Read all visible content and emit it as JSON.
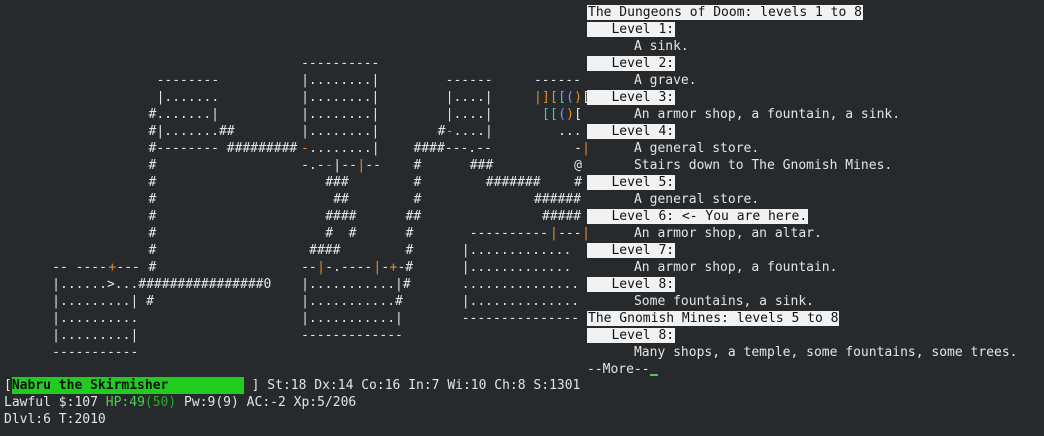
{
  "overview": {
    "lines": [
      {
        "text": "The Dungeons of Doom: levels 1 to 8",
        "kind": "header"
      },
      {
        "text": "   Level 1:",
        "kind": "level"
      },
      {
        "text": "      A sink.",
        "kind": "detail"
      },
      {
        "text": "   Level 2:",
        "kind": "level"
      },
      {
        "text": "      A grave.",
        "kind": "detail"
      },
      {
        "text": "   Level 3:",
        "kind": "level"
      },
      {
        "text": "      An armor shop, a fountain, a sink.",
        "kind": "detail"
      },
      {
        "text": "   Level 4:",
        "kind": "level"
      },
      {
        "text": "      A general store.",
        "kind": "detail"
      },
      {
        "text": "      Stairs down to The Gnomish Mines.",
        "kind": "detail"
      },
      {
        "text": "   Level 5:",
        "kind": "level"
      },
      {
        "text": "      A general store.",
        "kind": "detail"
      },
      {
        "text": "   Level 6: <- You are here.",
        "kind": "level"
      },
      {
        "text": "      An armor shop, an altar.",
        "kind": "detail"
      },
      {
        "text": "   Level 7:",
        "kind": "level"
      },
      {
        "text": "      An armor shop, a fountain.",
        "kind": "detail"
      },
      {
        "text": "   Level 8:",
        "kind": "level"
      },
      {
        "text": "      Some fountains, a sink.",
        "kind": "detail"
      },
      {
        "text": "The Gnomish Mines: levels 5 to 8",
        "kind": "header"
      },
      {
        "text": "   Level 8:",
        "kind": "level"
      },
      {
        "text": "      Many shops, a temple, some fountains, some trees.",
        "kind": "detail"
      }
    ],
    "more_prompt": "--More--"
  },
  "status": {
    "name": "Nabru the Skirmisher",
    "attributes": "] St:18 Dx:14 Co:16 In:7 Wi:10 Ch:8 S:1301",
    "alignment": "Lawful",
    "gold": "$:107",
    "hp_label": "HP:49",
    "hp_max": "(50)",
    "power": "Pw:9(9)",
    "ac": "AC:-2",
    "xp": "Xp:5/206",
    "dlvl": "Dlvl:6",
    "turn": "T:2010"
  },
  "map": {
    "rows": [
      {
        "row": 3,
        "segs": [
          {
            "col": 37,
            "text": "----------"
          }
        ]
      },
      {
        "row": 4,
        "segs": [
          {
            "col": 19,
            "text": "--------"
          },
          {
            "col": 37,
            "text": "|........|"
          },
          {
            "col": 55,
            "text": "------"
          },
          {
            "col": 66,
            "text": "------"
          }
        ]
      },
      {
        "row": 5,
        "segs": [
          {
            "col": 19,
            "text": "|......."
          },
          {
            "col": 37,
            "text": "|........|"
          },
          {
            "col": 55,
            "text": "|....|"
          },
          {
            "col": 66,
            "text": "|",
            "cls": "o"
          },
          {
            "col": 67,
            "text": "]",
            "cls": "o"
          },
          {
            "col": 68,
            "text": "[",
            "cls": "o"
          },
          {
            "col": 69,
            "text": "[",
            "cls": "c"
          },
          {
            "col": 70,
            "text": "(",
            "cls": "b"
          },
          {
            "col": 71,
            "text": ")",
            "cls": "o"
          },
          {
            "col": 72,
            "text": "["
          }
        ]
      },
      {
        "row": 6,
        "segs": [
          {
            "col": 18,
            "text": "#.......|"
          },
          {
            "col": 37,
            "text": "|........|"
          },
          {
            "col": 55,
            "text": "|....|"
          },
          {
            "col": 67,
            "text": "[",
            "cls": "c"
          },
          {
            "col": 68,
            "text": "[",
            "cls": "c"
          },
          {
            "col": 69,
            "text": "(",
            "cls": "b"
          },
          {
            "col": 70,
            "text": ")",
            "cls": "o"
          },
          {
            "col": 71,
            "text": "["
          }
        ]
      },
      {
        "row": 7,
        "segs": [
          {
            "col": 18,
            "text": "#|.......##"
          },
          {
            "col": 37,
            "text": "|........|"
          },
          {
            "col": 54,
            "text": "#"
          },
          {
            "col": 55,
            "text": "-",
            "cls": "o"
          },
          {
            "col": 56,
            "text": "....|"
          },
          {
            "col": 69,
            "text": "..."
          }
        ]
      },
      {
        "row": 8,
        "segs": [
          {
            "col": 18,
            "text": "#-------- #########"
          },
          {
            "col": 37,
            "text": "-",
            "cls": "o"
          },
          {
            "col": 38,
            "text": "........|"
          },
          {
            "col": 51,
            "text": "####---.--"
          },
          {
            "col": 71,
            "text": "-"
          },
          {
            "col": 72,
            "text": "|",
            "cls": "o"
          }
        ]
      },
      {
        "row": 9,
        "segs": [
          {
            "col": 18,
            "text": "#"
          },
          {
            "col": 37,
            "text": "-.-"
          },
          {
            "col": 40,
            "text": "-",
            "cls": "o"
          },
          {
            "col": 41,
            "text": "|"
          },
          {
            "col": 42,
            "text": "--"
          },
          {
            "col": 44,
            "text": "|",
            "cls": "o"
          },
          {
            "col": 45,
            "text": "--"
          },
          {
            "col": 51,
            "text": "#"
          },
          {
            "col": 58,
            "text": "###"
          },
          {
            "col": 71,
            "text": "@"
          }
        ]
      },
      {
        "row": 10,
        "segs": [
          {
            "col": 18,
            "text": "#"
          },
          {
            "col": 40,
            "text": "###"
          },
          {
            "col": 51,
            "text": "#"
          },
          {
            "col": 60,
            "text": "#######"
          },
          {
            "col": 71,
            "text": "#"
          }
        ]
      },
      {
        "row": 11,
        "segs": [
          {
            "col": 18,
            "text": "#"
          },
          {
            "col": 41,
            "text": "##"
          },
          {
            "col": 51,
            "text": "#"
          },
          {
            "col": 66,
            "text": "######"
          }
        ]
      },
      {
        "row": 12,
        "segs": [
          {
            "col": 18,
            "text": "#"
          },
          {
            "col": 40,
            "text": "####"
          },
          {
            "col": 50,
            "text": "##"
          },
          {
            "col": 67,
            "text": "#####"
          }
        ]
      },
      {
        "row": 13,
        "segs": [
          {
            "col": 18,
            "text": "#"
          },
          {
            "col": 40,
            "text": "#  #"
          },
          {
            "col": 50,
            "text": "#"
          },
          {
            "col": 58,
            "text": "----------"
          },
          {
            "col": 68,
            "text": "|",
            "cls": "o"
          },
          {
            "col": 69,
            "text": "---"
          },
          {
            "col": 72,
            "text": "|",
            "cls": "o"
          }
        ]
      },
      {
        "row": 14,
        "segs": [
          {
            "col": 18,
            "text": "#"
          },
          {
            "col": 38,
            "text": "####"
          },
          {
            "col": 50,
            "text": "#"
          },
          {
            "col": 57,
            "text": "|............."
          }
        ]
      },
      {
        "row": 15,
        "segs": [
          {
            "col": 6,
            "text": "-- ----"
          },
          {
            "col": 13,
            "text": "+",
            "cls": "o"
          },
          {
            "col": 14,
            "text": "---"
          },
          {
            "col": 18,
            "text": "#"
          },
          {
            "col": 37,
            "text": "--"
          },
          {
            "col": 39,
            "text": "|",
            "cls": "o"
          },
          {
            "col": 40,
            "text": "-.----"
          },
          {
            "col": 46,
            "text": "|",
            "cls": "o"
          },
          {
            "col": 47,
            "text": "-"
          },
          {
            "col": 48,
            "text": "+",
            "cls": "o"
          },
          {
            "col": 49,
            "text": "-#"
          },
          {
            "col": 57,
            "text": "|............."
          }
        ]
      },
      {
        "row": 16,
        "segs": [
          {
            "col": 6,
            "text": "|......>...################0"
          },
          {
            "col": 37,
            "text": "|...........|#"
          },
          {
            "col": 57,
            "text": "..............."
          }
        ]
      },
      {
        "row": 17,
        "segs": [
          {
            "col": 6,
            "text": "|.........| #"
          },
          {
            "col": 37,
            "text": "|...........#"
          },
          {
            "col": 57,
            "text": "|.............."
          }
        ]
      },
      {
        "row": 18,
        "segs": [
          {
            "col": 6,
            "text": "|.........."
          },
          {
            "col": 37,
            "text": "|...........|"
          },
          {
            "col": 57,
            "text": "---------------"
          }
        ]
      },
      {
        "row": 19,
        "segs": [
          {
            "col": 6,
            "text": "|.........|"
          },
          {
            "col": 37,
            "text": "-------------"
          }
        ]
      },
      {
        "row": 20,
        "segs": [
          {
            "col": 6,
            "text": "-----------"
          }
        ]
      }
    ]
  }
}
